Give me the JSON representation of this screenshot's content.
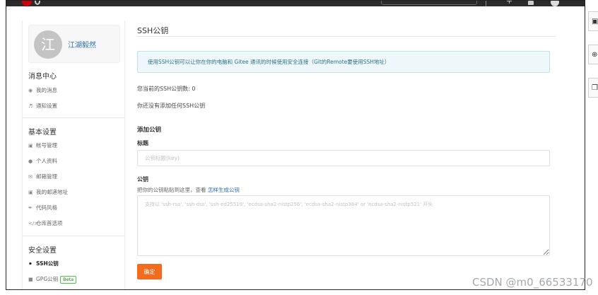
{
  "user": {
    "avatar_char": "江",
    "name": "江湖毅然"
  },
  "sidebar": {
    "messages": {
      "title": "消息中心",
      "items": [
        {
          "icon": "bell-icon",
          "label": "我的消息"
        },
        {
          "icon": "speaker-icon",
          "label": "通知设置"
        }
      ]
    },
    "basic": {
      "title": "基本设置",
      "items": [
        {
          "icon": "id-card-icon",
          "label": "帐号管理"
        },
        {
          "icon": "user-icon",
          "label": "个人资料"
        },
        {
          "icon": "mail-icon",
          "label": "邮箱管理"
        },
        {
          "icon": "address-card-icon",
          "label": "我的邮递地址"
        },
        {
          "icon": "brush-icon",
          "label": "代码风格"
        },
        {
          "icon": "code-icon",
          "label": "仓库首选项"
        }
      ]
    },
    "security": {
      "title": "安全设置",
      "items": [
        {
          "icon": "key-icon",
          "label": "SSH公钥",
          "active": true
        },
        {
          "icon": "lock-icon",
          "label": "GPG公钥",
          "badge": "Beta"
        }
      ]
    }
  },
  "main": {
    "title": "SSH公钥",
    "info": "使用SSH公钥可以让你在你的电脑和 Gitee 通讯的时候使用安全连接（Git的Remote要使用SSH地址）",
    "count_label": "您当前的SSH公钥数: 0",
    "none_text": "你还没有添加任何SSH公钥",
    "add_title": "添加公钥",
    "title_label": "标题",
    "title_placeholder": "公钥标题(key)",
    "key_label": "公钥",
    "key_hint": "把你的公钥粘贴到这里，查看 ",
    "key_hint_link": "怎样生成公钥",
    "key_placeholder": "支持以 'ssh-rsa', 'ssh-dss', 'ssh-ed25519', 'ecdsa-sha2-nistp256', 'ecdsa-sha2-nistp384' or 'ecdsa-sha2-nistp521' 开头",
    "submit_label": "确定"
  },
  "watermark": "CSDN @m0_66533170",
  "colors": {
    "primary_button": "#f36c1d",
    "link": "#2b6cb0",
    "info_bg": "#eef8fb"
  }
}
